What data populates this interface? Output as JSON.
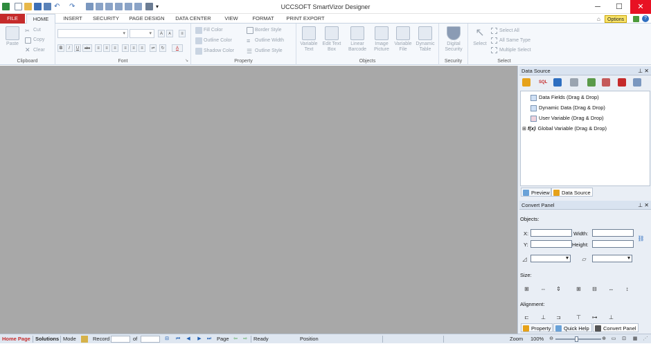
{
  "window": {
    "title": "UCCSOFT SmartVizor Designer",
    "minimize": "─",
    "maximize": "☐",
    "close": "✕"
  },
  "tabs": [
    "FILE",
    "HOME",
    "INSERT",
    "SECURITY",
    "PAGE DESIGN",
    "DATA CENTER",
    "VIEW",
    "FORMAT",
    "PRINT EXPORT"
  ],
  "options_label": "Options",
  "ribbon": {
    "clipboard": {
      "label": "Clipboard",
      "paste": "Paste",
      "cut": "Cut",
      "copy": "Copy",
      "clear": "Clear"
    },
    "font": {
      "label": "Font",
      "bold": "B",
      "italic": "I",
      "underline": "U",
      "strike": "abc",
      "grow": "A",
      "shrink": "A",
      "color": "A"
    },
    "property": {
      "label": "Property",
      "fill_color": "Fill Color",
      "outline_color": "Outline Color",
      "shadow_color": "Shadow Color",
      "border_style": "Border Style",
      "outline_width": "Outline Width",
      "outline_style": "Outline Style"
    },
    "objects": {
      "label": "Objects",
      "items": [
        "Variable Text",
        "Edit Text Box",
        "Linear Barcode",
        "Image Picture",
        "Variable File",
        "Dynamic Table"
      ]
    },
    "security": {
      "label": "Security",
      "digital": "Digital Security"
    },
    "select": {
      "label": "Select",
      "select": "Select",
      "select_all": "Select All",
      "all_same_type": "All Same Type",
      "multiple_select": "Multiple Select"
    }
  },
  "data_source": {
    "title": "Data Source",
    "tree": [
      "Data Fields (Drag & Drop)",
      "Dynamic Data (Drag & Drop)",
      "User Variable (Drag & Drop)",
      "Global Variable (Drag & Drop)"
    ],
    "tabs": [
      "Preview",
      "Data Source"
    ]
  },
  "convert_panel": {
    "title": "Convert Panel",
    "objects_label": "Objects:",
    "x_label": "X:",
    "y_label": "Y:",
    "width_label": "Width:",
    "height_label": "Height:",
    "size_label": "Size:",
    "alignment_label": "Alignment:",
    "tabs": [
      "Property",
      "Quick Help",
      "Convert Panel"
    ]
  },
  "statusbar": {
    "home_page": "Home Page",
    "solutions": "Solutions",
    "mode": "Mode",
    "record": "Record",
    "of": "of",
    "page": "Page",
    "ready": "Ready",
    "position": "Position",
    "zoom_label": "Zoom",
    "zoom_value": "100%"
  }
}
